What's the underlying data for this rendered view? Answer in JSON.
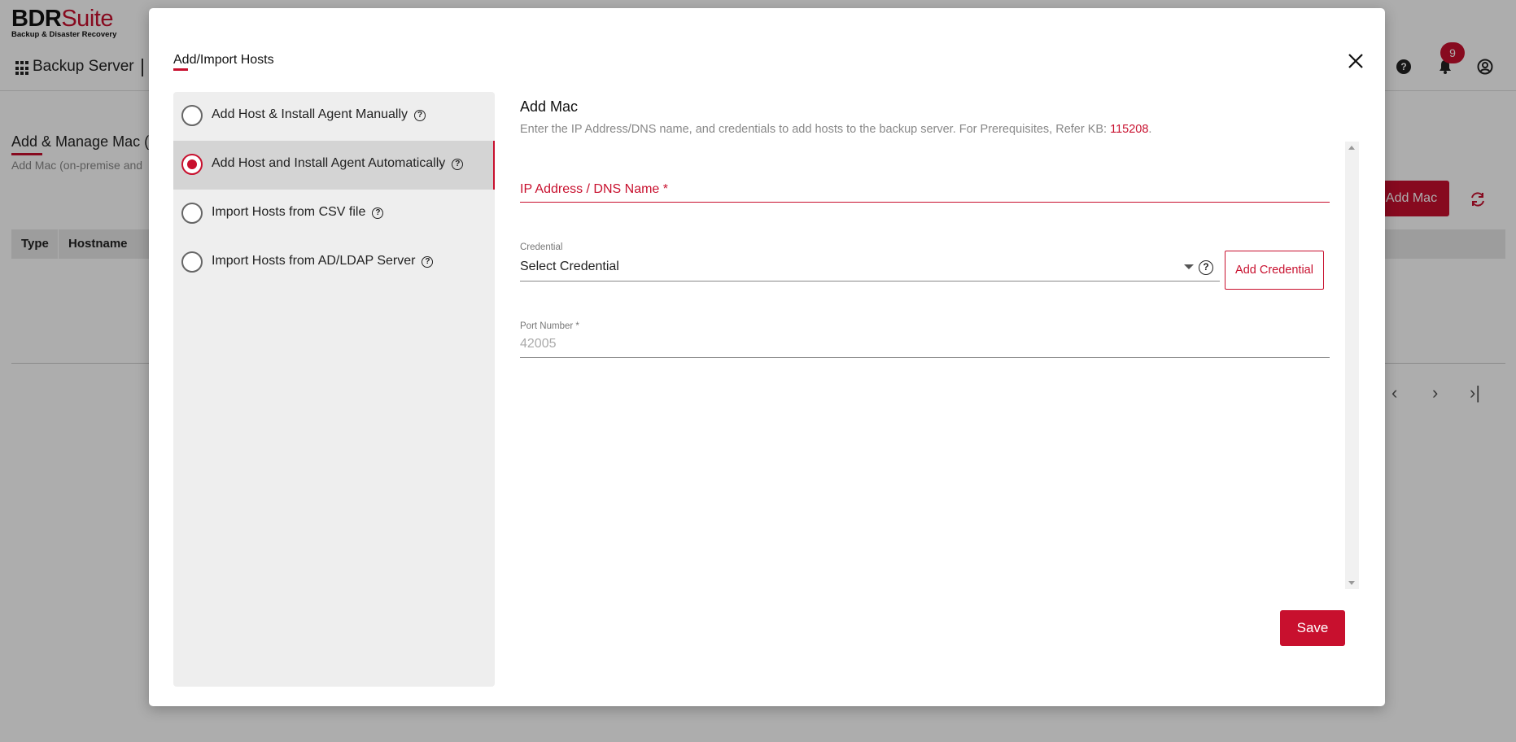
{
  "app": {
    "logo_main_a": "BDR",
    "logo_main_b": "Suite",
    "logo_sub": "Backup & Disaster Recovery",
    "nav_title": "Backup Server",
    "notifications_count": "9",
    "page_title": "Add & Manage Mac (F",
    "page_subtitle": "Add Mac (on-premise and",
    "add_mac_label": "Add Mac",
    "table_headers": [
      "Type",
      "Hostname"
    ],
    "pager": {
      "prev": "‹",
      "next": "›",
      "last": "›|"
    },
    "icons": [
      "apps-icon",
      "help-icon",
      "bell-icon",
      "user-icon",
      "refresh-icon"
    ]
  },
  "modal": {
    "title": "Add/Import Hosts",
    "close_icon": "close-icon",
    "options": [
      {
        "label": "Add Host & Install Agent Manually",
        "selected": false
      },
      {
        "label": "Add Host and Install Agent Automatically",
        "selected": true
      },
      {
        "label": "Import Hosts from CSV file",
        "selected": false
      },
      {
        "label": "Import Hosts from AD/LDAP Server",
        "selected": false
      }
    ],
    "heading": "Add Mac",
    "description_prefix": "Enter the IP Address/DNS name, and credentials to add hosts to the backup server. For Prerequisites, Refer KB: ",
    "description_kb": "115208",
    "description_suffix": ".",
    "ip_label": "IP Address / DNS Name *",
    "ip_value": "",
    "credential_caption": "Credential",
    "credential_value": "Select Credential",
    "add_credential_label": "Add Credential",
    "port_caption": "Port Number *",
    "port_value": "42005",
    "save_label": "Save"
  },
  "colors": {
    "accent": "#c8102e",
    "overlay": "rgba(0,0,0,0.32)"
  }
}
